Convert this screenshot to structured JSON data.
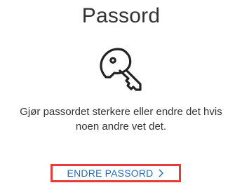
{
  "card": {
    "title": "Passord",
    "icon": "key-icon",
    "description_line1": "Gjør passordet sterkere eller endre det hvis",
    "description_line2": "noen andre vet det.",
    "action_label": "ENDRE PASSORD",
    "action_chevron": ">",
    "colors": {
      "text": "#333333",
      "link": "#1f6fb8",
      "highlight_border": "#e63b3b"
    }
  }
}
